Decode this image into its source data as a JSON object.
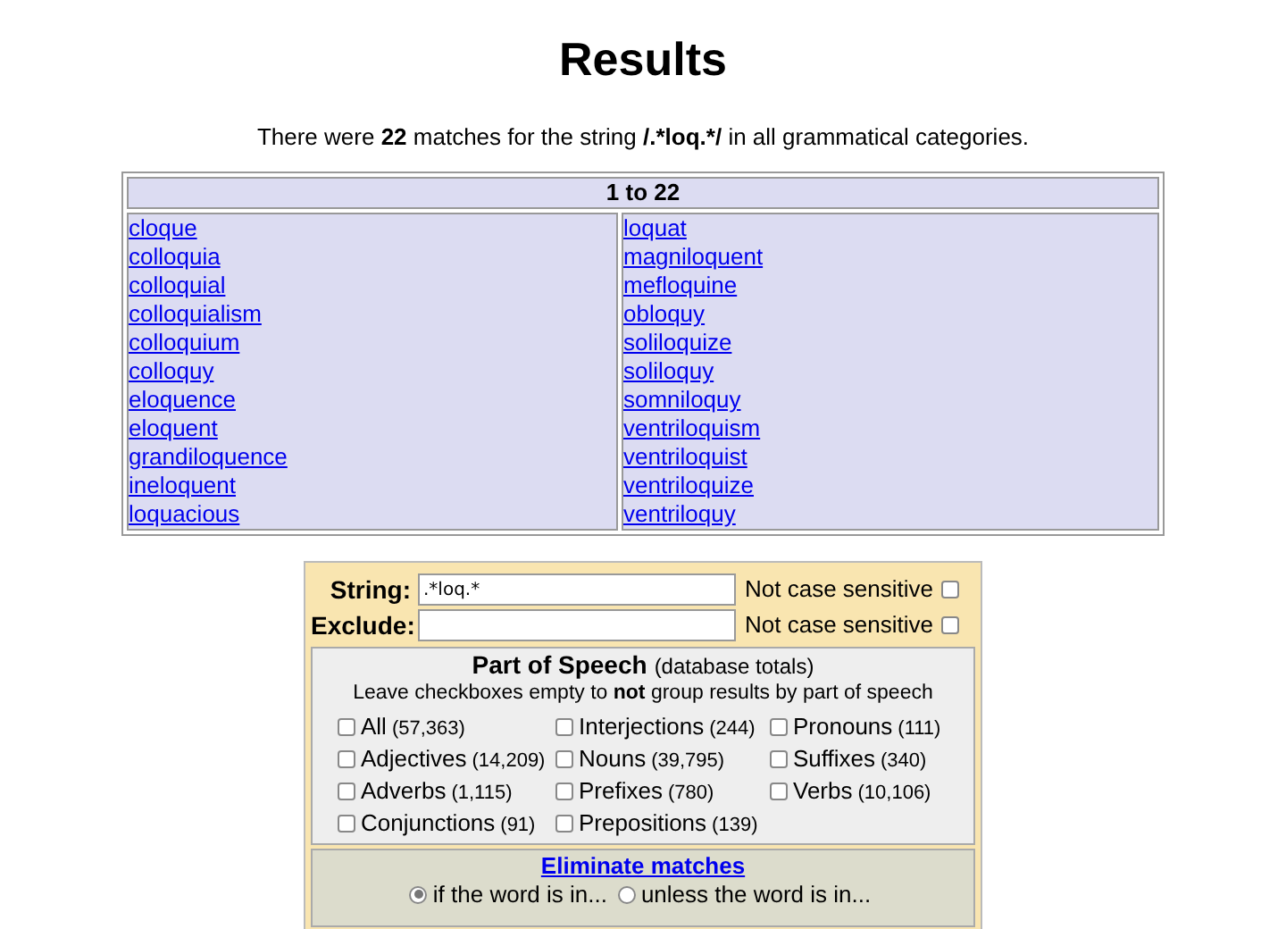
{
  "title": "Results",
  "summary": [
    {
      "text": "There were ",
      "bold": false
    },
    {
      "text": "22",
      "bold": true
    },
    {
      "text": " matches for the string ",
      "bold": false
    },
    {
      "text": "/.*loq.*/",
      "bold": true
    },
    {
      "text": " in all grammatical categories.",
      "bold": false
    }
  ],
  "table": {
    "header": "1 to 22",
    "columns": [
      [
        "cloque",
        "colloquia",
        "colloquial",
        "colloquialism",
        "colloquium",
        "colloquy",
        "eloquence",
        "eloquent",
        "grandiloquence",
        "ineloquent",
        "loquacious"
      ],
      [
        "loquat",
        "magniloquent",
        "mefloquine",
        "obloquy",
        "soliloquize",
        "soliloquy",
        "somniloquy",
        "ventriloquism",
        "ventriloquist",
        "ventriloquize",
        "ventriloquy"
      ]
    ]
  },
  "form": {
    "fields": [
      {
        "label": "String:",
        "value": ".*loq.*",
        "option": "Not case sensitive",
        "checked": false
      },
      {
        "label": "Exclude:",
        "option": "Not case sensitive",
        "checked": false
      }
    ],
    "part_of_speech": {
      "heading": "Part of Speech",
      "note": "(database totals)",
      "instruction": [
        {
          "text": "Leave checkboxes empty to ",
          "bold": false
        },
        {
          "text": "not",
          "bold": true
        },
        {
          "text": " group results by part of speech",
          "bold": false
        }
      ],
      "options": [
        {
          "label": "All",
          "count": "(57,363)",
          "checked": false
        },
        {
          "label": "Interjections",
          "count": "(244)",
          "checked": false
        },
        {
          "label": "Pronouns",
          "count": "(111)",
          "checked": false
        },
        {
          "label": "Adjectives",
          "count": "(14,209)",
          "checked": false
        },
        {
          "label": "Nouns",
          "count": "(39,795)",
          "checked": false
        },
        {
          "label": "Suffixes",
          "count": "(340)",
          "checked": false
        },
        {
          "label": "Adverbs",
          "count": "(1,115)",
          "checked": false
        },
        {
          "label": "Prefixes",
          "count": "(780)",
          "checked": false
        },
        {
          "label": "Verbs",
          "count": "(10,106)",
          "checked": false
        },
        {
          "label": "Conjunctions",
          "count": "(91)",
          "checked": false
        },
        {
          "label": "Prepositions",
          "count": "(139)",
          "checked": false
        }
      ]
    },
    "eliminate": {
      "link": "Eliminate matches",
      "radios": [
        {
          "label": "if the word is in...",
          "selected": true
        },
        {
          "label": "unless the word is in...",
          "selected": false
        }
      ]
    }
  }
}
